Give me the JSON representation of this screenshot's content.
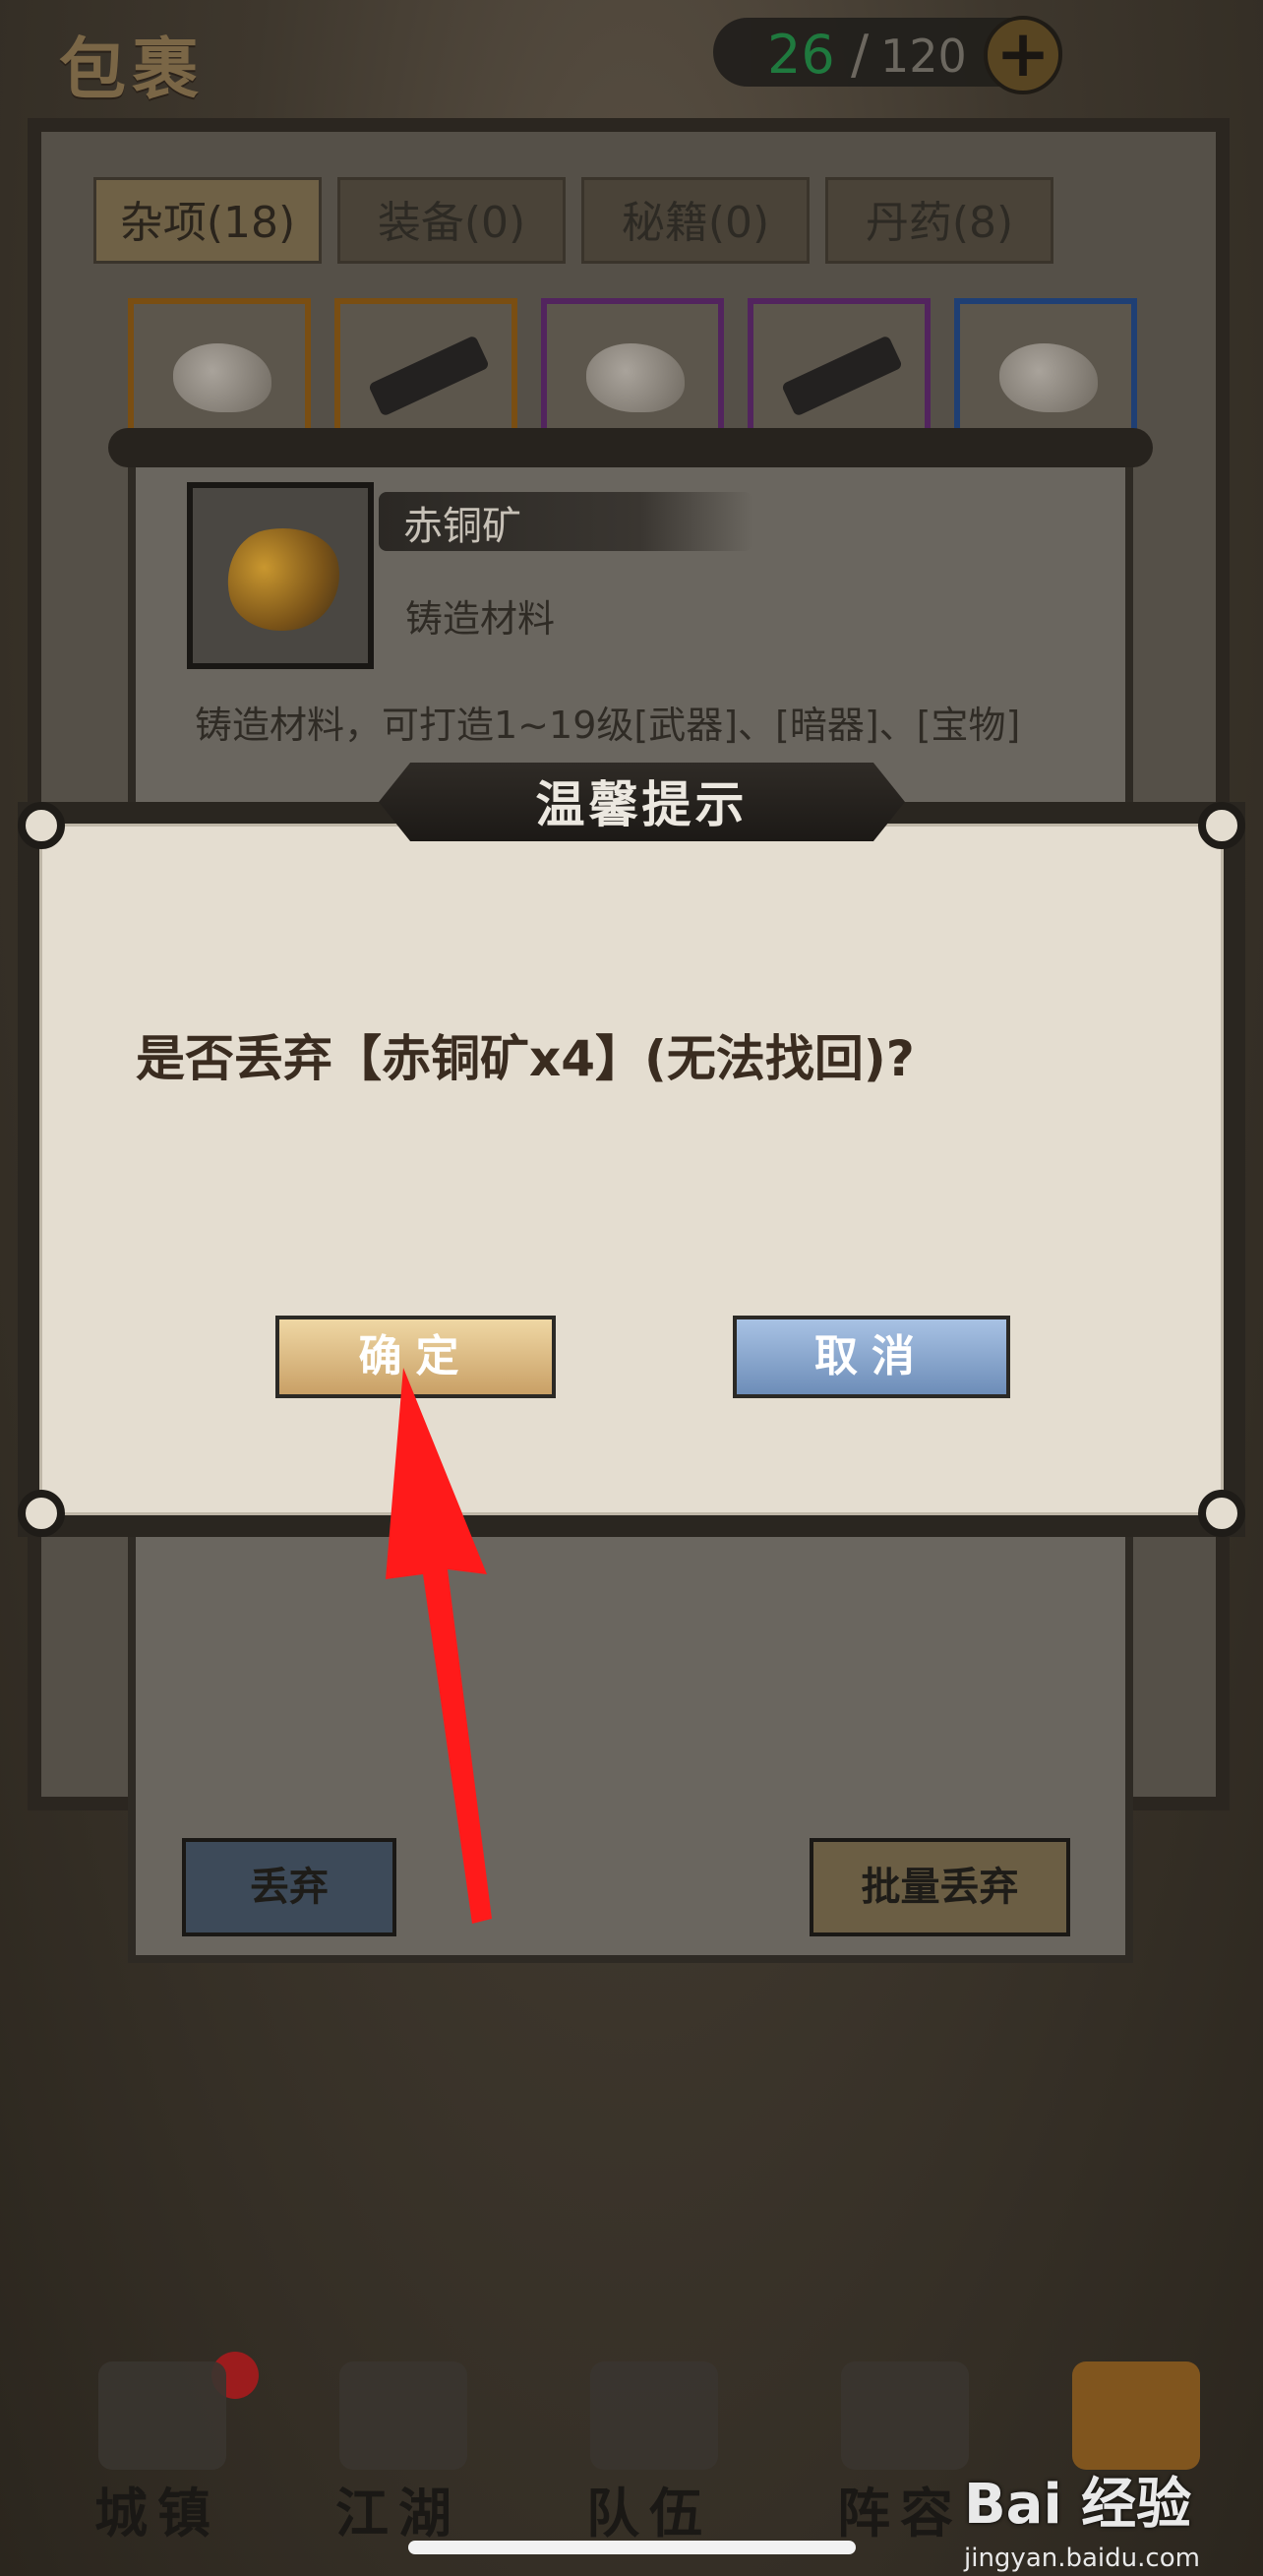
{
  "header": {
    "title": "包裹",
    "capacity_used": "26",
    "capacity_sep": "/",
    "capacity_total": "120",
    "add_icon": "plus-icon"
  },
  "tabs": [
    {
      "label": "杂项(18)",
      "active": true
    },
    {
      "label": "装备(0)",
      "active": false
    },
    {
      "label": "秘籍(0)",
      "active": false
    },
    {
      "label": "丹药(8)",
      "active": false
    }
  ],
  "slots": [
    {
      "kind": "ore",
      "rarity": "orange"
    },
    {
      "kind": "bar",
      "rarity": "orange"
    },
    {
      "kind": "ore",
      "rarity": "purple"
    },
    {
      "kind": "bar",
      "rarity": "purple"
    },
    {
      "kind": "ore",
      "rarity": "blue"
    }
  ],
  "item": {
    "name": "赤铜矿",
    "type": "铸造材料",
    "description": "铸造材料，可打造1~19级[武器]、[暗器]、[宝物]"
  },
  "detail_buttons": {
    "discard": "丢弃",
    "batch_discard": "批量丢弃"
  },
  "dialog": {
    "title": "温馨提示",
    "message": "是否丢弃【赤铜矿x4】(无法找回)?",
    "ok": "确定",
    "cancel": "取消"
  },
  "nav": [
    {
      "label": "城镇"
    },
    {
      "label": "江湖"
    },
    {
      "label": "队伍"
    },
    {
      "label": "阵容"
    },
    {
      "label": ""
    }
  ],
  "watermark": {
    "logo": "Bai 经验",
    "url": "jingyan.baidu.com"
  },
  "colors": {
    "ok_button": "#c9a066",
    "cancel_button": "#6d8db8",
    "arrow": "#ff1a1a",
    "capacity_used": "#1d7c3f"
  }
}
